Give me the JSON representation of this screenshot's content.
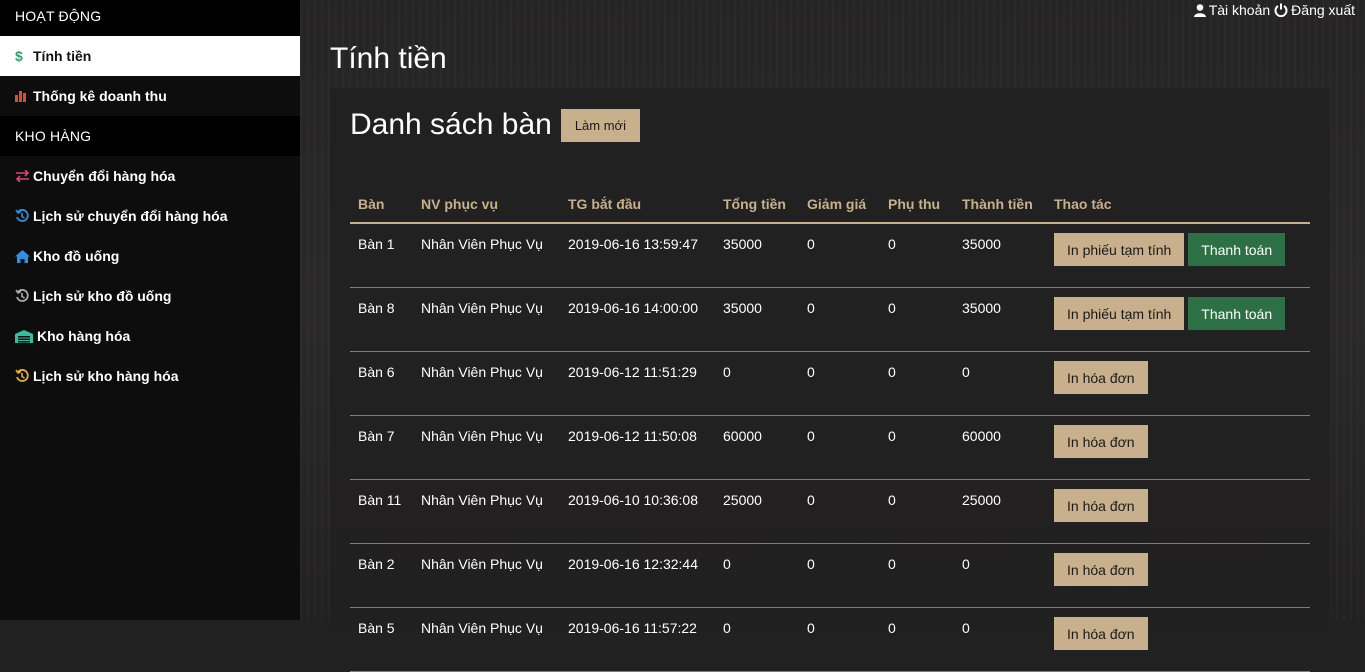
{
  "sidebar": {
    "section1": "HOẠT ĐỘNG",
    "section2": "KHO HÀNG",
    "items": [
      {
        "label": "Tính tiền",
        "icon": "dollar-icon",
        "color": "#2fa36b"
      },
      {
        "label": "Thống kê doanh thu",
        "icon": "bar-chart-icon",
        "color": "#e04c2f"
      },
      {
        "label": "Chuyển đổi hàng hóa",
        "icon": "exchange-icon",
        "color": "#e0446b"
      },
      {
        "label": "Lịch sử chuyển đổi hàng hóa",
        "icon": "history-icon",
        "color": "#2f8fe0"
      },
      {
        "label": "Kho đồ uống",
        "icon": "home-icon",
        "color": "#2f8fe0"
      },
      {
        "label": "Lịch sử kho đồ uống",
        "icon": "history-icon",
        "color": "#aaaaaa"
      },
      {
        "label": "Kho hàng hóa",
        "icon": "warehouse-icon",
        "color": "#2fbfa0"
      },
      {
        "label": "Lịch sử kho hàng hóa",
        "icon": "history-icon",
        "color": "#e0b02f"
      }
    ]
  },
  "topbar": {
    "account": "Tài khoản",
    "logout": "Đăng xuất"
  },
  "page_title": "Tính tiền",
  "panel": {
    "title": "Danh sách bàn",
    "refresh_label": "Làm mới"
  },
  "table": {
    "headers": [
      "Bàn",
      "NV phục vụ",
      "TG bắt đầu",
      "Tổng tiền",
      "Giảm giá",
      "Phụ thu",
      "Thành tiền",
      "Thao tác"
    ],
    "rows": [
      {
        "ban": "Bàn 1",
        "nv": "Nhân Viên Phục Vụ",
        "tg": "2019-06-16 13:59:47",
        "tong": "35000",
        "giam": "0",
        "phu": "0",
        "thanh": "35000",
        "buttons": [
          "In phiếu tạm tính",
          "Thanh toán"
        ]
      },
      {
        "ban": "Bàn 8",
        "nv": "Nhân Viên Phục Vụ",
        "tg": "2019-06-16 14:00:00",
        "tong": "35000",
        "giam": "0",
        "phu": "0",
        "thanh": "35000",
        "buttons": [
          "In phiếu tạm tính",
          "Thanh toán"
        ]
      },
      {
        "ban": "Bàn 6",
        "nv": "Nhân Viên Phục Vụ",
        "tg": "2019-06-12 11:51:29",
        "tong": "0",
        "giam": "0",
        "phu": "0",
        "thanh": "0",
        "buttons": [
          "In hóa đơn"
        ]
      },
      {
        "ban": "Bàn 7",
        "nv": "Nhân Viên Phục Vụ",
        "tg": "2019-06-12 11:50:08",
        "tong": "60000",
        "giam": "0",
        "phu": "0",
        "thanh": "60000",
        "buttons": [
          "In hóa đơn"
        ]
      },
      {
        "ban": "Bàn 11",
        "nv": "Nhân Viên Phục Vụ",
        "tg": "2019-06-10 10:36:08",
        "tong": "25000",
        "giam": "0",
        "phu": "0",
        "thanh": "25000",
        "buttons": [
          "In hóa đơn"
        ]
      },
      {
        "ban": "Bàn 2",
        "nv": "Nhân Viên Phục Vụ",
        "tg": "2019-06-16 12:32:44",
        "tong": "0",
        "giam": "0",
        "phu": "0",
        "thanh": "0",
        "buttons": [
          "In hóa đơn"
        ]
      },
      {
        "ban": "Bàn 5",
        "nv": "Nhân Viên Phục Vụ",
        "tg": "2019-06-16 11:57:22",
        "tong": "0",
        "giam": "0",
        "phu": "0",
        "thanh": "0",
        "buttons": [
          "In hóa đơn"
        ]
      }
    ]
  },
  "colors": {
    "accent_gold": "#c7b08b",
    "pay_green": "#2e7045"
  }
}
